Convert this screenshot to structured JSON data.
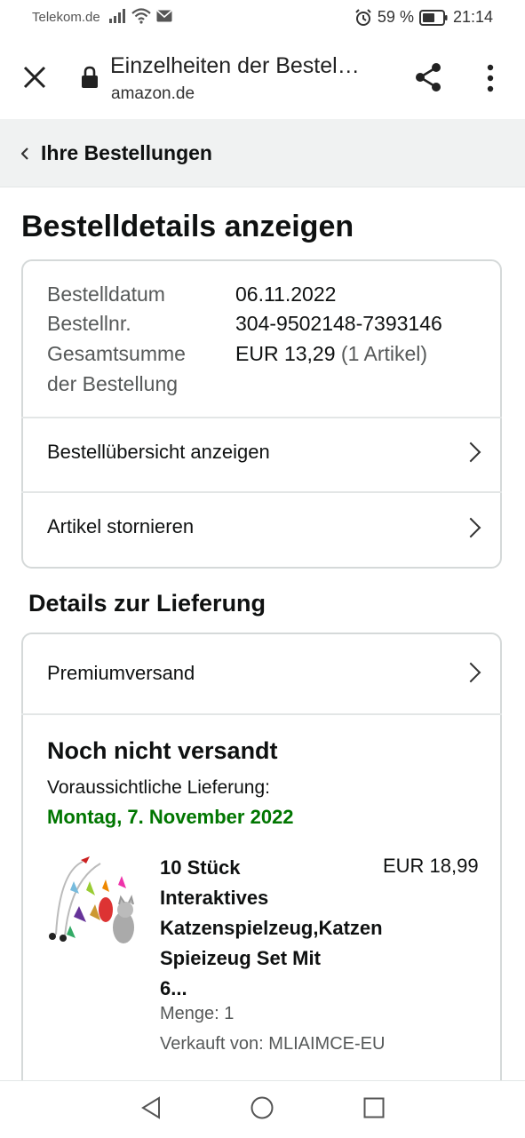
{
  "status_bar": {
    "carrier": "Telekom.de",
    "battery": "59 %",
    "time": "21:14"
  },
  "browser": {
    "title": "Einzelheiten der Bestel…",
    "domain": "amazon.de"
  },
  "breadcrumb": {
    "label": "Ihre Bestellungen"
  },
  "page_title": "Bestelldetails anzeigen",
  "order": {
    "date_label": "Bestelldatum",
    "date_value": "06.11.2022",
    "number_label": "Bestellnr.",
    "number_value": "304-9502148-7393146",
    "total_label_1": "Gesamtsumme",
    "total_label_2": "der Bestellung",
    "total_value": "EUR 13,29",
    "total_items": "(1 Artikel)"
  },
  "actions": {
    "summary": "Bestellübersicht anzeigen",
    "cancel": "Artikel stornieren"
  },
  "delivery": {
    "section_title": "Details zur Lieferung",
    "shipping_method": "Premiumversand",
    "status": "Noch nicht versandt",
    "expected_label": "Voraussichtliche Lieferung:",
    "expected_date": "Montag, 7. November 2022"
  },
  "item": {
    "title_lines": [
      "10 Stück",
      "Interaktives",
      "Katzenspielzeug,Katzen",
      "Spieizeug Set Mit",
      "6..."
    ],
    "price": "EUR 18,99",
    "quantity": "Menge: 1",
    "seller": "Verkauft von: MLIAIMCE-EU"
  },
  "colors": {
    "accent_green": "#007600",
    "text": "#0f1111",
    "muted": "#565959",
    "border": "#d5d9d9"
  }
}
